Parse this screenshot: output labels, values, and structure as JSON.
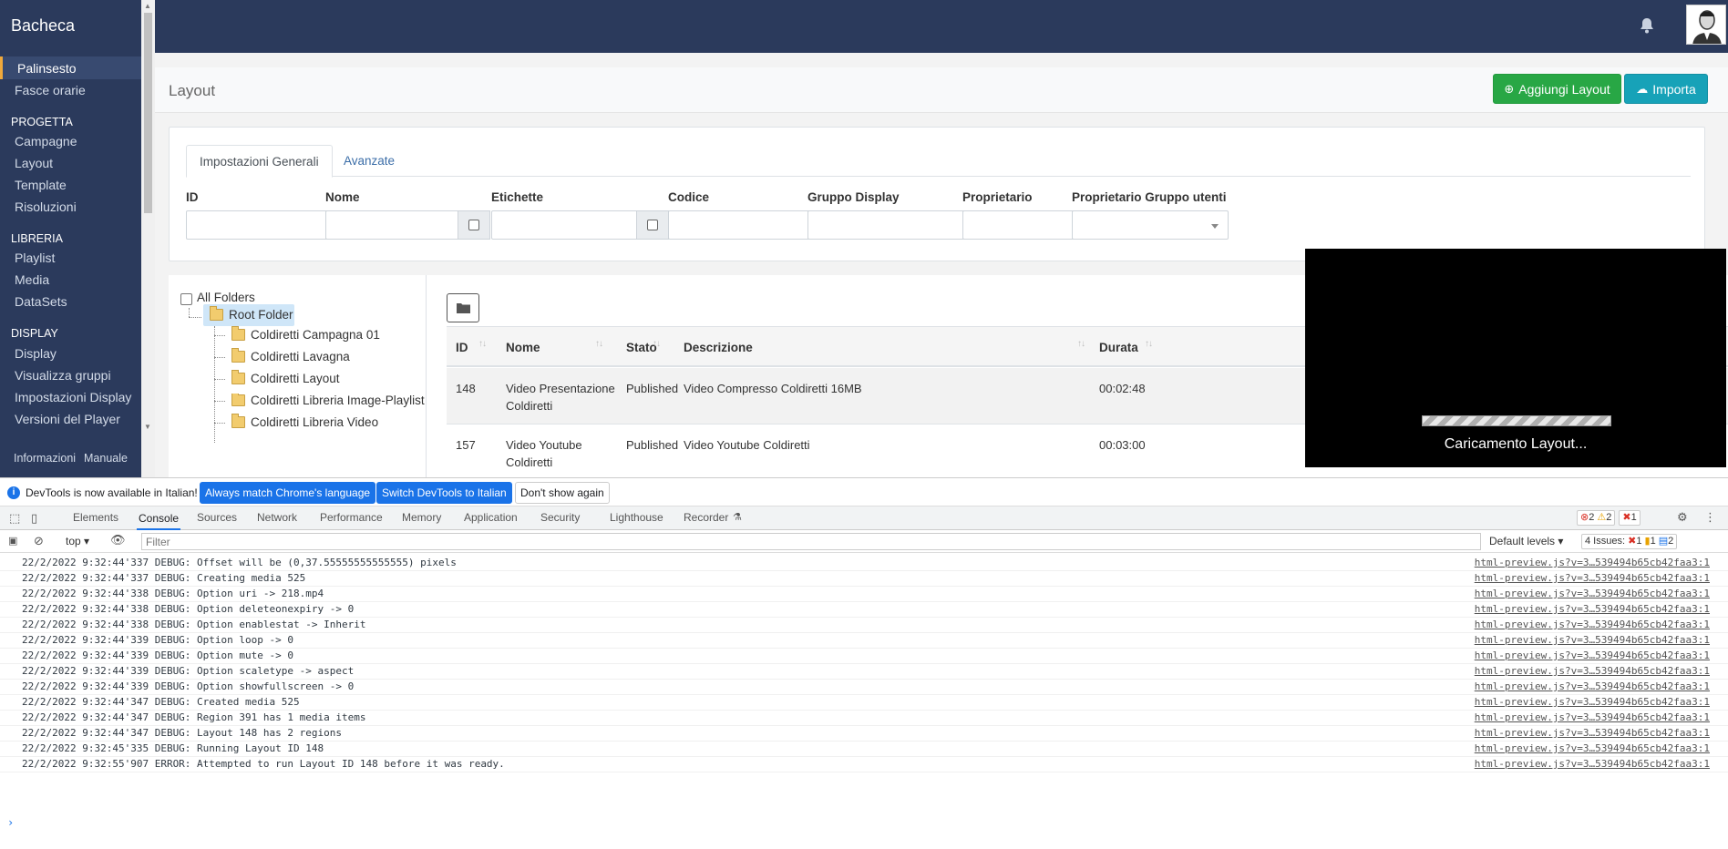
{
  "sidebar": {
    "brand": "Bacheca",
    "items_top": [
      {
        "label": "Palinsesto",
        "active": true
      },
      {
        "label": "Fasce orarie"
      }
    ],
    "sections": [
      {
        "title": "PROGETTA",
        "items": [
          "Campagne",
          "Layout",
          "Template",
          "Risoluzioni"
        ]
      },
      {
        "title": "LIBRERIA",
        "items": [
          "Playlist",
          "Media",
          "DataSets"
        ]
      },
      {
        "title": "DISPLAY",
        "items": [
          "Display",
          "Visualizza gruppi",
          "Impostazioni Display",
          "Versioni del Player"
        ]
      }
    ],
    "footer": [
      "Informazioni",
      "Manuale"
    ]
  },
  "header": {
    "title": "Layout",
    "add_button": "Aggiungi Layout",
    "import_button": "Importa"
  },
  "filters": {
    "tabs": [
      "Impostazioni Generali",
      "Avanzate"
    ],
    "labels": [
      "ID",
      "Nome",
      "Etichette",
      "Codice",
      "Gruppo Display",
      "Proprietario",
      "Proprietario Gruppo utenti"
    ]
  },
  "folders": {
    "all_label": "All Folders",
    "root": "Root Folder",
    "children": [
      "Coldiretti Campagna 01",
      "Coldiretti Lavagna",
      "Coldiretti Layout",
      "Coldiretti Libreria Image-Playlist",
      "Coldiretti Libreria Video"
    ]
  },
  "table": {
    "columns": [
      "ID",
      "Nome",
      "Stato",
      "Descrizione",
      "Durata"
    ],
    "rows": [
      {
        "id": "148",
        "nome": "Video Presentazione Coldiretti",
        "stato": "Published",
        "descrizione": "Video Compresso Coldiretti 16MB",
        "durata": "00:02:48"
      },
      {
        "id": "157",
        "nome": "Video Youtube Coldiretti",
        "stato": "Published",
        "descrizione": "Video Youtube Coldiretti",
        "durata": "00:03:00"
      }
    ]
  },
  "preview": {
    "loading_text": "Caricamento Layout..."
  },
  "devtools": {
    "banner": {
      "message": "DevTools is now available in Italian!",
      "btn_match": "Always match Chrome's language",
      "btn_switch": "Switch DevTools to Italian",
      "btn_dismiss": "Don't show again"
    },
    "tabs": [
      "Elements",
      "Console",
      "Sources",
      "Network",
      "Performance",
      "Memory",
      "Application",
      "Security",
      "Lighthouse",
      "Recorder"
    ],
    "selected_tab": "Console",
    "badges": {
      "errors": "2",
      "warnings": "2",
      "blocked": "1"
    },
    "toolbar": {
      "context": "top",
      "filter_placeholder": "Filter",
      "levels": "Default levels",
      "issues_label": "4 Issues:",
      "issues_err": "1",
      "issues_warn": "1",
      "issues_info": "2"
    },
    "logs": [
      {
        "text": "22/2/2022 9:32:44'337 DEBUG: Offset will be (0,37.55555555555555) pixels",
        "source": "html-preview.js?v=3…539494b65cb42faa3:1"
      },
      {
        "text": "22/2/2022 9:32:44'337 DEBUG: Creating media 525",
        "source": "html-preview.js?v=3…539494b65cb42faa3:1"
      },
      {
        "text": "22/2/2022 9:32:44'338 DEBUG: Option uri -> 218.mp4",
        "source": "html-preview.js?v=3…539494b65cb42faa3:1"
      },
      {
        "text": "22/2/2022 9:32:44'338 DEBUG: Option deleteonexpiry -> 0",
        "source": "html-preview.js?v=3…539494b65cb42faa3:1"
      },
      {
        "text": "22/2/2022 9:32:44'338 DEBUG: Option enablestat -> Inherit",
        "source": "html-preview.js?v=3…539494b65cb42faa3:1"
      },
      {
        "text": "22/2/2022 9:32:44'339 DEBUG: Option loop -> 0",
        "source": "html-preview.js?v=3…539494b65cb42faa3:1"
      },
      {
        "text": "22/2/2022 9:32:44'339 DEBUG: Option mute -> 0",
        "source": "html-preview.js?v=3…539494b65cb42faa3:1"
      },
      {
        "text": "22/2/2022 9:32:44'339 DEBUG: Option scaletype -> aspect",
        "source": "html-preview.js?v=3…539494b65cb42faa3:1"
      },
      {
        "text": "22/2/2022 9:32:44'339 DEBUG: Option showfullscreen -> 0",
        "source": "html-preview.js?v=3…539494b65cb42faa3:1"
      },
      {
        "text": "22/2/2022 9:32:44'347 DEBUG: Created media 525",
        "source": "html-preview.js?v=3…539494b65cb42faa3:1"
      },
      {
        "text": "22/2/2022 9:32:44'347 DEBUG: Region 391 has 1 media items",
        "source": "html-preview.js?v=3…539494b65cb42faa3:1"
      },
      {
        "text": "22/2/2022 9:32:44'347 DEBUG: Layout 148 has 2 regions",
        "source": "html-preview.js?v=3…539494b65cb42faa3:1"
      },
      {
        "text": "22/2/2022 9:32:45'335 DEBUG: Running Layout ID 148",
        "source": "html-preview.js?v=3…539494b65cb42faa3:1"
      },
      {
        "text": "22/2/2022 9:32:55'907 ERROR: Attempted to run Layout ID 148 before it was ready.",
        "source": "html-preview.js?v=3…539494b65cb42faa3:1"
      }
    ]
  },
  "colors": {
    "sidebar_bg": "#2b3a5c",
    "accent": "#f0a93b",
    "success": "#28a745",
    "info": "#17a2b8",
    "devtools_blue": "#1a73e8"
  }
}
